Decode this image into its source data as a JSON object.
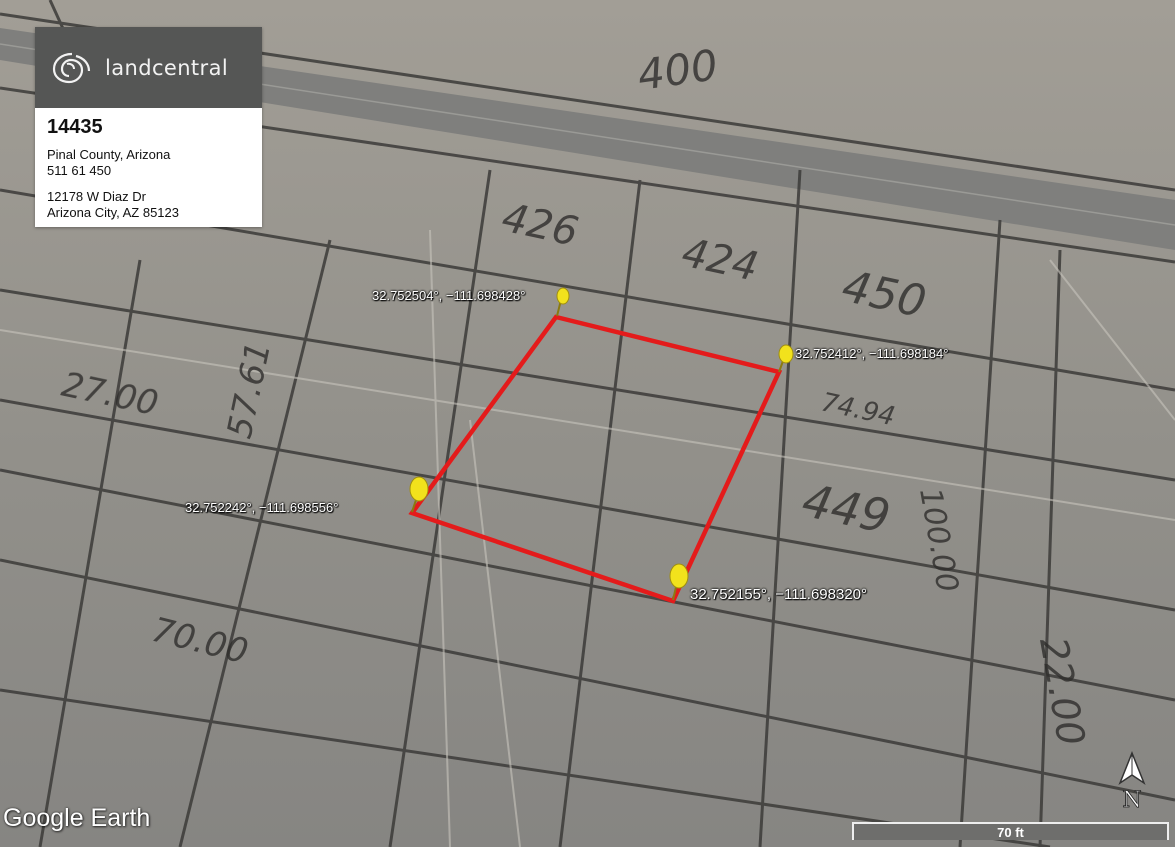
{
  "brand": {
    "logo_text": "landcentral",
    "logo_icon": "spiral-swirl-icon"
  },
  "parcel": {
    "id": "14435",
    "county": "Pinal County, Arizona",
    "apn": "511 61 450",
    "street": "12178 W Diaz Dr",
    "city": "Arizona City, AZ 85123"
  },
  "boundary": {
    "color": "#e41b1b",
    "pin_color": "#f2e21c",
    "corners": [
      {
        "label": "32.752504°, −111.698428°"
      },
      {
        "label": "32.752412°, −111.698184°"
      },
      {
        "label": "32.752155°, −111.698320°"
      },
      {
        "label": "32.752242°, −111.698556°"
      }
    ]
  },
  "map_labels": [
    "400",
    "426",
    "424",
    "450",
    "449",
    "22.00",
    "27.00",
    "70.00",
    "100.00",
    "74.94",
    "57.61"
  ],
  "attribution": "Google Earth",
  "scale": {
    "label": "70 ft"
  },
  "compass": {
    "label": "N",
    "icon": "north-arrow-icon"
  }
}
